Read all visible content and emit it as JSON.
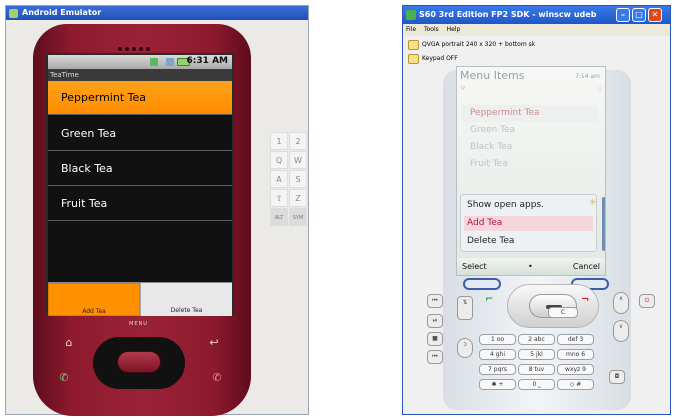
{
  "android": {
    "window_title": "Android Emulator",
    "status_time": "6:31 AM",
    "app_title": "TeaTime",
    "items": [
      "Peppermint Tea",
      "Green Tea",
      "Black Tea",
      "Fruit Tea"
    ],
    "menu": {
      "add": "Add Tea",
      "delete": "Delete Tea"
    },
    "menu_key_label": "MENU",
    "keyboard": [
      {
        "key": "1"
      },
      {
        "key": "2"
      },
      {
        "key": "Q"
      },
      {
        "key": "W"
      },
      {
        "key": "A"
      },
      {
        "key": "S"
      },
      {
        "key": "⇧"
      },
      {
        "key": "Z"
      },
      {
        "key": "ALT"
      },
      {
        "key": "SYM"
      }
    ]
  },
  "s60": {
    "window_title": "S60 3rd Edition FP2 SDK - winscw udeb",
    "menubar": [
      "File",
      "Tools",
      "Help"
    ],
    "toolbar": [
      "QVGA portrait 240 x 320 + bottom sk",
      "Keypad OFF"
    ],
    "screen_title": "Menu Items",
    "screen_time": "7:14 am",
    "signal_glyph": "Ψ",
    "battery_glyph": "▯",
    "items": [
      "Peppermint Tea",
      "Green Tea",
      "Black Tea",
      "Fruit Tea"
    ],
    "popup": [
      "Show open apps.",
      "Add Tea",
      "Delete Tea"
    ],
    "softkeys": {
      "left": "Select",
      "middle": "•",
      "right": "Cancel"
    },
    "keypad": [
      {
        "k": "1 ᴏᴏ"
      },
      {
        "k": "2 abc"
      },
      {
        "k": "def 3"
      },
      {
        "k": "4 ghi"
      },
      {
        "k": "5 jkl"
      },
      {
        "k": "mno 6"
      },
      {
        "k": "7 pqrs"
      },
      {
        "k": "8 tuv"
      },
      {
        "k": "wxyz 9"
      },
      {
        "k": "✱ +"
      },
      {
        "k": "0 ⎵"
      },
      {
        "k": "◇ #"
      }
    ],
    "clear_key": "C"
  },
  "colors": {
    "android_accent": "#ff8c00",
    "s60_highlight": "#b1124a",
    "phone_red": "#8e1a2e"
  }
}
